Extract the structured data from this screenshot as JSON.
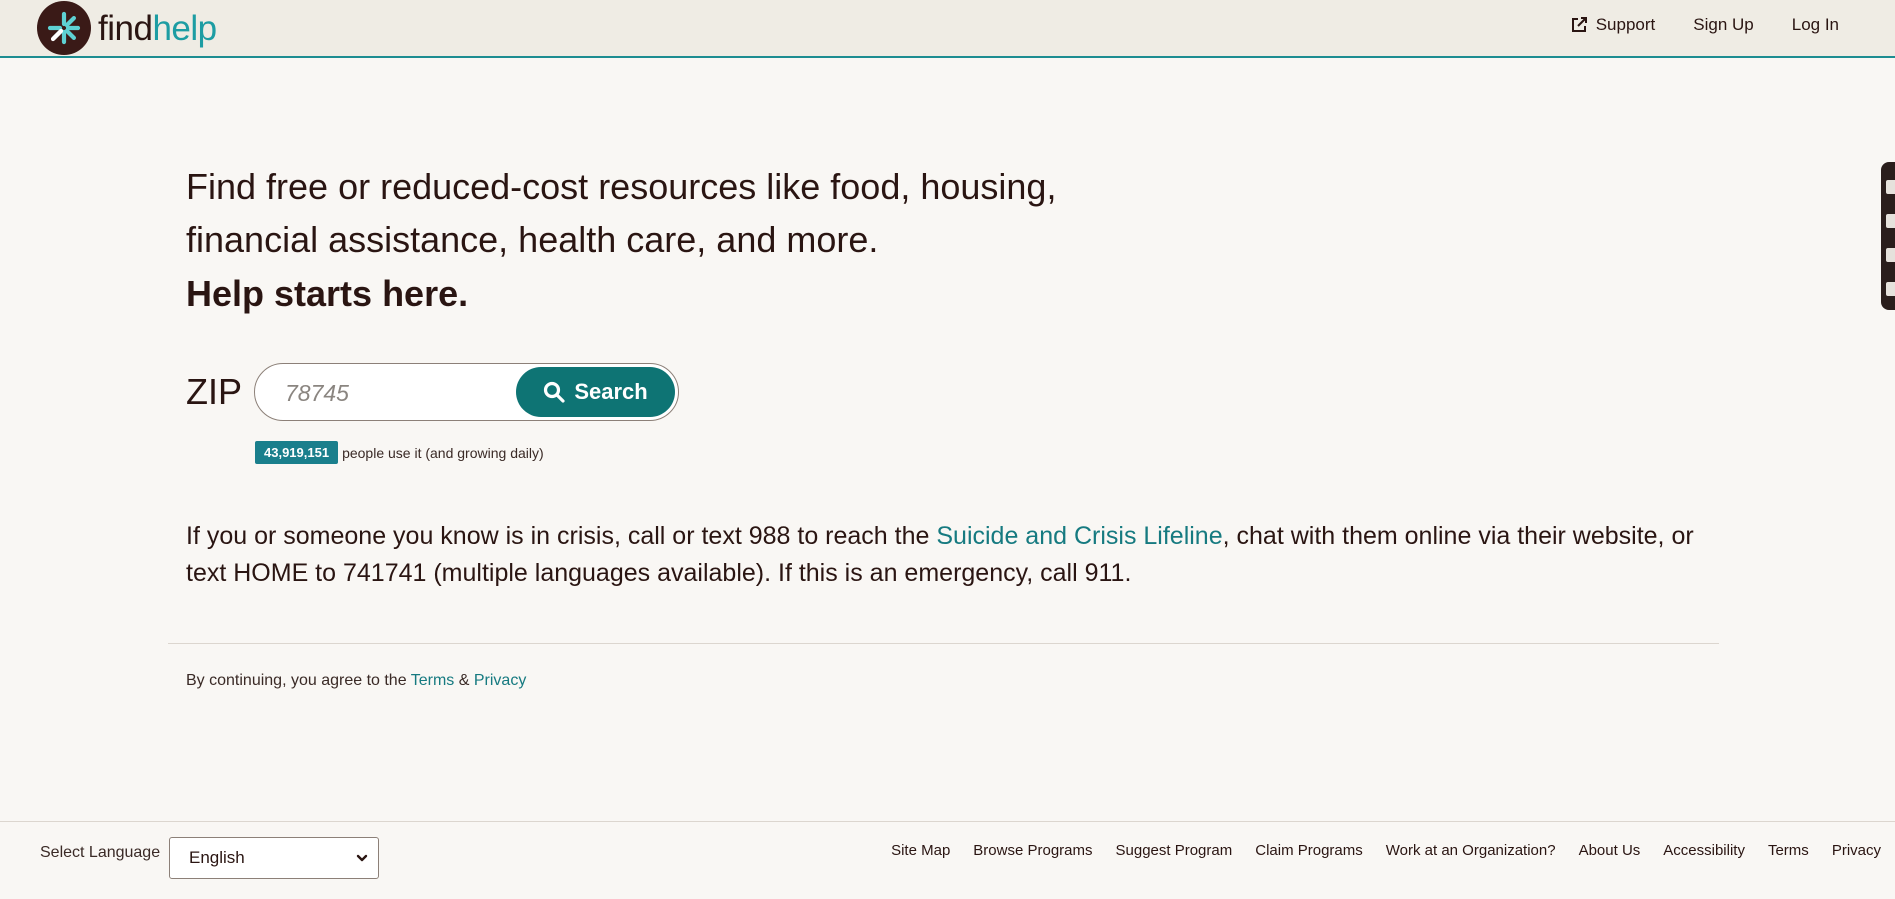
{
  "brand": {
    "find": "find",
    "help": "help",
    "accent_color": "#1d9da3",
    "primary_color": "#0e7474",
    "dark_color": "#2a1512"
  },
  "nav": {
    "support": "Support",
    "signup": "Sign Up",
    "login": "Log In"
  },
  "hero": {
    "line1": "Find free or reduced-cost resources like food, housing,",
    "line2": "financial assistance, health care, and more.",
    "strong": "Help starts here."
  },
  "search": {
    "zip_label": "ZIP",
    "zip_placeholder": "78745",
    "button_label": "Search"
  },
  "counter": {
    "count": "43,919,151",
    "text": "people use it (and growing daily)"
  },
  "crisis": {
    "part1": "If you or someone you know is in crisis, call or text 988 to reach the ",
    "link": "Suicide and Crisis Lifeline",
    "part2": ", chat with them online via their website, or text HOME to 741741 (multiple languages available). If this is an emergency, call 911."
  },
  "legal": {
    "prefix": "By continuing, you agree to the ",
    "terms": "Terms",
    "amp": " & ",
    "privacy": "Privacy"
  },
  "footer": {
    "lang_label": "Select Language",
    "lang_value": "English",
    "links": [
      "Site Map",
      "Browse Programs",
      "Suggest Program",
      "Claim Programs",
      "Work at an Organization?",
      "About Us",
      "Accessibility",
      "Terms",
      "Privacy"
    ]
  }
}
